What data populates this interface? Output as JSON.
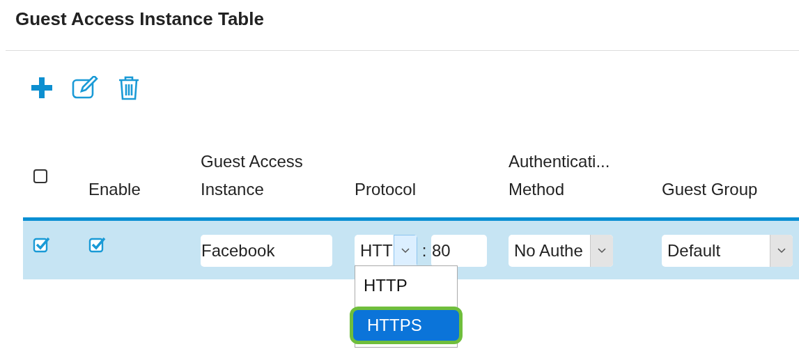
{
  "title": "Guest Access Instance Table",
  "table": {
    "header_checkbox": {
      "checked": false
    },
    "columns": [
      "Enable",
      "Guest Access Instance",
      "Protocol",
      "Authenticati... Method",
      "Guest Group"
    ],
    "rows": [
      {
        "selected": true,
        "enabled": true,
        "instance": "Facebook",
        "protocol": "HTT",
        "separator": ":",
        "port": "80",
        "authentication_method": "No Authe",
        "guest_group": "Default"
      }
    ]
  },
  "protocol_dropdown": {
    "expanded": true,
    "options": [
      {
        "label": "HTTP",
        "selected": false
      },
      {
        "label": "HTTPS",
        "selected": true
      }
    ]
  }
}
